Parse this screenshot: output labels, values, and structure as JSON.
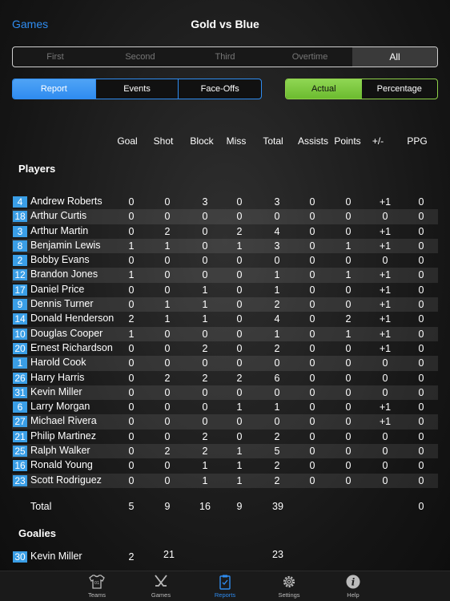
{
  "nav": {
    "back": "Games",
    "title": "Gold vs Blue"
  },
  "periods": [
    {
      "label": "First",
      "active": false
    },
    {
      "label": "Second",
      "active": false
    },
    {
      "label": "Third",
      "active": false
    },
    {
      "label": "Overtime",
      "active": false
    },
    {
      "label": "All",
      "active": true
    }
  ],
  "views": [
    {
      "label": "Report",
      "active": true
    },
    {
      "label": "Events",
      "active": false
    },
    {
      "label": "Face-Offs",
      "active": false
    }
  ],
  "modes": [
    {
      "label": "Actual",
      "active": true
    },
    {
      "label": "Percentage",
      "active": false
    }
  ],
  "columns": [
    "Goal",
    "Shot",
    "Block",
    "Miss",
    "Total",
    "Assists",
    "Points",
    "+/-",
    "PPG"
  ],
  "sections": {
    "players": "Players",
    "goalies": "Goalies"
  },
  "players": [
    {
      "num": "4",
      "name": "Andrew Roberts",
      "stats": [
        "0",
        "0",
        "3",
        "0",
        "3",
        "0",
        "0",
        "+1",
        "0"
      ]
    },
    {
      "num": "18",
      "name": "Arthur Curtis",
      "stats": [
        "0",
        "0",
        "0",
        "0",
        "0",
        "0",
        "0",
        "0",
        "0"
      ]
    },
    {
      "num": "3",
      "name": "Arthur Martin",
      "stats": [
        "0",
        "2",
        "0",
        "2",
        "4",
        "0",
        "0",
        "+1",
        "0"
      ]
    },
    {
      "num": "8",
      "name": "Benjamin Lewis",
      "stats": [
        "1",
        "1",
        "0",
        "1",
        "3",
        "0",
        "1",
        "+1",
        "0"
      ]
    },
    {
      "num": "2",
      "name": "Bobby Evans",
      "stats": [
        "0",
        "0",
        "0",
        "0",
        "0",
        "0",
        "0",
        "0",
        "0"
      ]
    },
    {
      "num": "12",
      "name": "Brandon Jones",
      "stats": [
        "1",
        "0",
        "0",
        "0",
        "1",
        "0",
        "1",
        "+1",
        "0"
      ]
    },
    {
      "num": "17",
      "name": "Daniel Price",
      "stats": [
        "0",
        "0",
        "1",
        "0",
        "1",
        "0",
        "0",
        "+1",
        "0"
      ]
    },
    {
      "num": "9",
      "name": "Dennis Turner",
      "stats": [
        "0",
        "1",
        "1",
        "0",
        "2",
        "0",
        "0",
        "+1",
        "0"
      ]
    },
    {
      "num": "14",
      "name": "Donald Henderson",
      "stats": [
        "2",
        "1",
        "1",
        "0",
        "4",
        "0",
        "2",
        "+1",
        "0"
      ]
    },
    {
      "num": "10",
      "name": "Douglas Cooper",
      "stats": [
        "1",
        "0",
        "0",
        "0",
        "1",
        "0",
        "1",
        "+1",
        "0"
      ]
    },
    {
      "num": "20",
      "name": "Ernest Richardson",
      "stats": [
        "0",
        "0",
        "2",
        "0",
        "2",
        "0",
        "0",
        "+1",
        "0"
      ]
    },
    {
      "num": "1",
      "name": "Harold Cook",
      "stats": [
        "0",
        "0",
        "0",
        "0",
        "0",
        "0",
        "0",
        "0",
        "0"
      ]
    },
    {
      "num": "26",
      "name": "Harry Harris",
      "stats": [
        "0",
        "2",
        "2",
        "2",
        "6",
        "0",
        "0",
        "0",
        "0"
      ]
    },
    {
      "num": "31",
      "name": "Kevin Miller",
      "stats": [
        "0",
        "0",
        "0",
        "0",
        "0",
        "0",
        "0",
        "0",
        "0"
      ]
    },
    {
      "num": "6",
      "name": "Larry Morgan",
      "stats": [
        "0",
        "0",
        "0",
        "1",
        "1",
        "0",
        "0",
        "+1",
        "0"
      ]
    },
    {
      "num": "27",
      "name": "Michael Rivera",
      "stats": [
        "0",
        "0",
        "0",
        "0",
        "0",
        "0",
        "0",
        "+1",
        "0"
      ]
    },
    {
      "num": "21",
      "name": "Philip Martinez",
      "stats": [
        "0",
        "0",
        "2",
        "0",
        "2",
        "0",
        "0",
        "0",
        "0"
      ]
    },
    {
      "num": "25",
      "name": "Ralph Walker",
      "stats": [
        "0",
        "2",
        "2",
        "1",
        "5",
        "0",
        "0",
        "0",
        "0"
      ]
    },
    {
      "num": "16",
      "name": "Ronald Young",
      "stats": [
        "0",
        "0",
        "1",
        "1",
        "2",
        "0",
        "0",
        "0",
        "0"
      ]
    },
    {
      "num": "23",
      "name": "Scott Rodriguez",
      "stats": [
        "0",
        "0",
        "1",
        "1",
        "2",
        "0",
        "0",
        "0",
        "0"
      ]
    }
  ],
  "totals": {
    "label": "Total",
    "goal": "5",
    "shot": "9",
    "block": "16",
    "miss": "9",
    "total": "39",
    "ppg": "0"
  },
  "goalies": [
    {
      "num": "30",
      "name": "Kevin Miller",
      "goal": "2",
      "shot": "21",
      "total": "23"
    }
  ],
  "tabs": [
    {
      "label": "Teams",
      "icon": "jersey-icon",
      "active": false
    },
    {
      "label": "Games",
      "icon": "hockey-sticks-icon",
      "active": false
    },
    {
      "label": "Reports",
      "icon": "clipboard-icon",
      "active": true
    },
    {
      "label": "Settings",
      "icon": "gear-icon",
      "active": false
    },
    {
      "label": "Help",
      "icon": "info-icon",
      "active": false
    }
  ],
  "colors": {
    "accent": "#2f8cf0",
    "badge": "#3a9ee6",
    "actual": "#7ec843"
  }
}
